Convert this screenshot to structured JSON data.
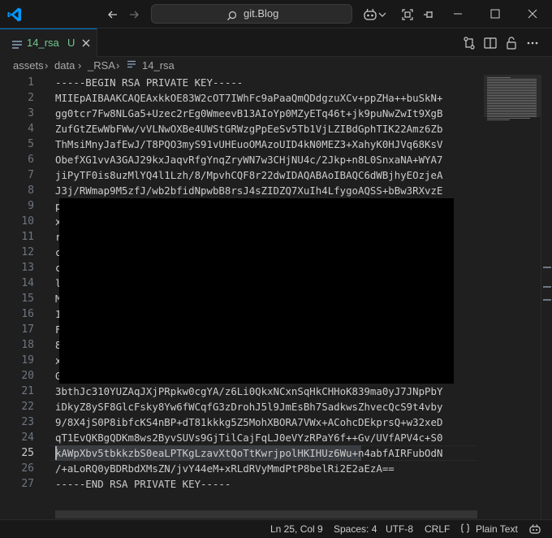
{
  "titlebar": {
    "search_text": "git.Blog",
    "icons": [
      "vscode-logo-icon",
      "back-arrow-icon",
      "forward-arrow-icon",
      "search-icon",
      "copilot-icon",
      "chevron-down-icon",
      "layout-icon",
      "pin-icon",
      "minimize-icon",
      "maximize-icon",
      "close-icon"
    ]
  },
  "tabs": [
    {
      "name": "14_rsa",
      "status": "U"
    }
  ],
  "tab_actions": [
    "git-compare-icon",
    "split-editor-icon",
    "lock-icon",
    "more-icon"
  ],
  "breadcrumb": [
    "assets",
    "data",
    "_RSA",
    "14_rsa"
  ],
  "editor": {
    "active_line": 25,
    "lines": [
      {
        "n": "1",
        "text": "-----BEGIN RSA PRIVATE KEY-----"
      },
      {
        "n": "2",
        "text": "MIIEpAIBAAKCAQEAxkkOE83W2cOT7IWhFc9aPaaQmQDdgzuXCv+ppZHa++buSkN+"
      },
      {
        "n": "3",
        "text": "gg0tcr7Fw8NLGa5+Uzec2rEg0WmeevB13AIoYp0MZyETq46t+jk9puNwZwIt9XgB"
      },
      {
        "n": "4",
        "text": "ZufGtZEwWbFWw/vVLNwOXBe4UWStGRWzgPpEeSv5Tb1VjLZIBdGphTIK22Amz6Zb"
      },
      {
        "n": "5",
        "text": "ThMsiMnyJafEwJ/T8PQO3myS91vUHEuoOMAzoUID4kN0MEZ3+XahyK0HJVq68KsV"
      },
      {
        "n": "6",
        "text": "ObefXG1vvA3GAJ29kxJaqvRfgYnqZryWN7w3CHjNU4c/2Jkp+n8L0SnxaNA+WYA7"
      },
      {
        "n": "7",
        "text": "jiPyTF0is8uzMlYQ4l1Lzh/8/MpvhCQF8r22dwIDAQABAoIBAQC6dWBjhyEOzjeA"
      },
      {
        "n": "8",
        "text": "J3j/RWmap9M5zfJ/wb2bfidNpwbB8rsJ4sZIDZQ7XuIh4LfygoAQSS+bBw3RXvzE"
      },
      {
        "n": "9",
        "text": "p                                                              r"
      },
      {
        "n": "10",
        "text": "x                                                              s"
      },
      {
        "n": "11",
        "text": "r                                                              D"
      },
      {
        "n": "12",
        "text": "c                                                              e"
      },
      {
        "n": "13",
        "text": "c                                                              r"
      },
      {
        "n": "14",
        "text": "l                                                              u"
      },
      {
        "n": "15",
        "text": "M                                                              L"
      },
      {
        "n": "16",
        "text": "1                                                              L"
      },
      {
        "n": "17",
        "text": "F                                                              Y"
      },
      {
        "n": "18",
        "text": "8                                                              t"
      },
      {
        "n": "19",
        "text": "x                                                              n"
      },
      {
        "n": "20",
        "text": "G                                                              k"
      },
      {
        "n": "21",
        "text": "3bthJc310YUZAqJXjPRpkw0cgYA/z6Li0QkxNCxnSqHkCHHoK839ma0yJ7JNpPbY"
      },
      {
        "n": "22",
        "text": "iDkyZ8ySF8GlcFsky8Yw6fWCqfG3zDrohJ5l9JmEsBh7SadkwsZhvecQcS9t4vby"
      },
      {
        "n": "23",
        "text": "9/8X4jS0P8ibfcKS4nBP+dT81kkkg5Z5MohXBORA7VWx+ACohcDEkprsQ+w32xeD"
      },
      {
        "n": "24",
        "text": "qT1EvQKBgQDKm8ws2ByvSUVs9GjTilCajFqLJ0eVYzRPaY6f++Gv/UVfAPV4c+S0"
      },
      {
        "n": "25",
        "text": "kAWpXbv5tbkkzbS0eaLPTKgLzavXtQoTtKwrjpolHKIHUz6Wu+n4abfAIRFubOdN"
      },
      {
        "n": "26",
        "text": "/+aLoRQ0yBDRbdXMsZN/jvY44eM+xRLdRVyMmdPtP8belRi2E2aEzA=="
      },
      {
        "n": "27",
        "text": "-----END RSA PRIVATE KEY-----"
      }
    ]
  },
  "statusbar": {
    "position": "Ln 25, Col 9",
    "spaces": "Spaces: 4",
    "encoding": "UTF-8",
    "eol": "CRLF",
    "language_icon": "braces-icon",
    "language": "Plain Text",
    "feedback_icon": "copilot-icon"
  },
  "colors": {
    "accent": "#0078d4",
    "untracked": "#73c991",
    "background": "#1f1f1f"
  }
}
